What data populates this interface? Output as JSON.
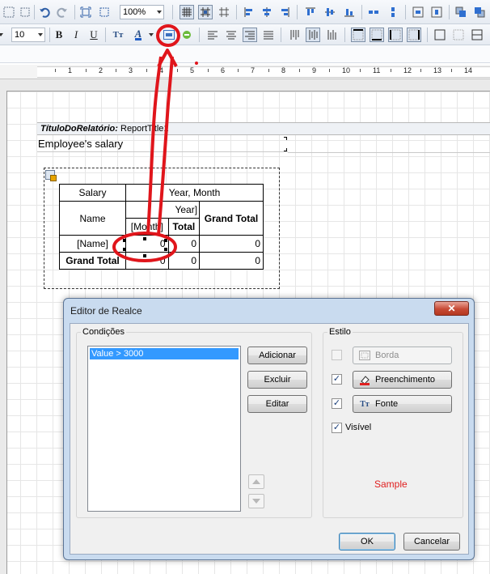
{
  "toolbar": {
    "zoom": "100%",
    "font_size": "10",
    "bold": "B",
    "italic": "I",
    "underline": "U",
    "text_style_glyph": "Tт",
    "font_color_glyph": "A"
  },
  "ruler": {
    "numbers": [
      "1",
      "2",
      "3",
      "4",
      "5",
      "6",
      "7",
      "8",
      "9",
      "10",
      "11",
      "12",
      "13",
      "14"
    ]
  },
  "report": {
    "band_label": "TítuloDoRelatório:",
    "band_name": "ReportTitle1",
    "title_text": "Employee's salary",
    "crosstab": {
      "salary": "Salary",
      "year_month": "Year, Month",
      "name_header": "Name",
      "year": "Year]",
      "grand_total_header": "Grand Total",
      "month": "[Month]",
      "total": "Total",
      "row_name": "[Name]",
      "row_grand_total": "Grand Total",
      "cell_month_1": "0",
      "cell_total_1": "0",
      "cell_grand_1": "0",
      "cell_month_2": "0",
      "cell_total_2": "0",
      "cell_grand_2": "0"
    }
  },
  "dialog": {
    "title": "Editor de Realce",
    "close_glyph": "✕",
    "conditions_label": "Condições",
    "conditions": [
      "Value > 3000"
    ],
    "add_button": "Adicionar",
    "delete_button": "Excluir",
    "edit_button": "Editar",
    "style_label": "Estilo",
    "border_button": "Borda",
    "fill_button": "Preenchimento",
    "font_button": "Fonte",
    "visible_label": "Visível",
    "sample_text": "Sample",
    "ok_button": "OK",
    "cancel_button": "Cancelar",
    "check_glyph": "✓"
  },
  "colors": {
    "annotation_red": "#e0151b",
    "sample_red": "#e02020",
    "selection_blue": "#3399ff"
  }
}
